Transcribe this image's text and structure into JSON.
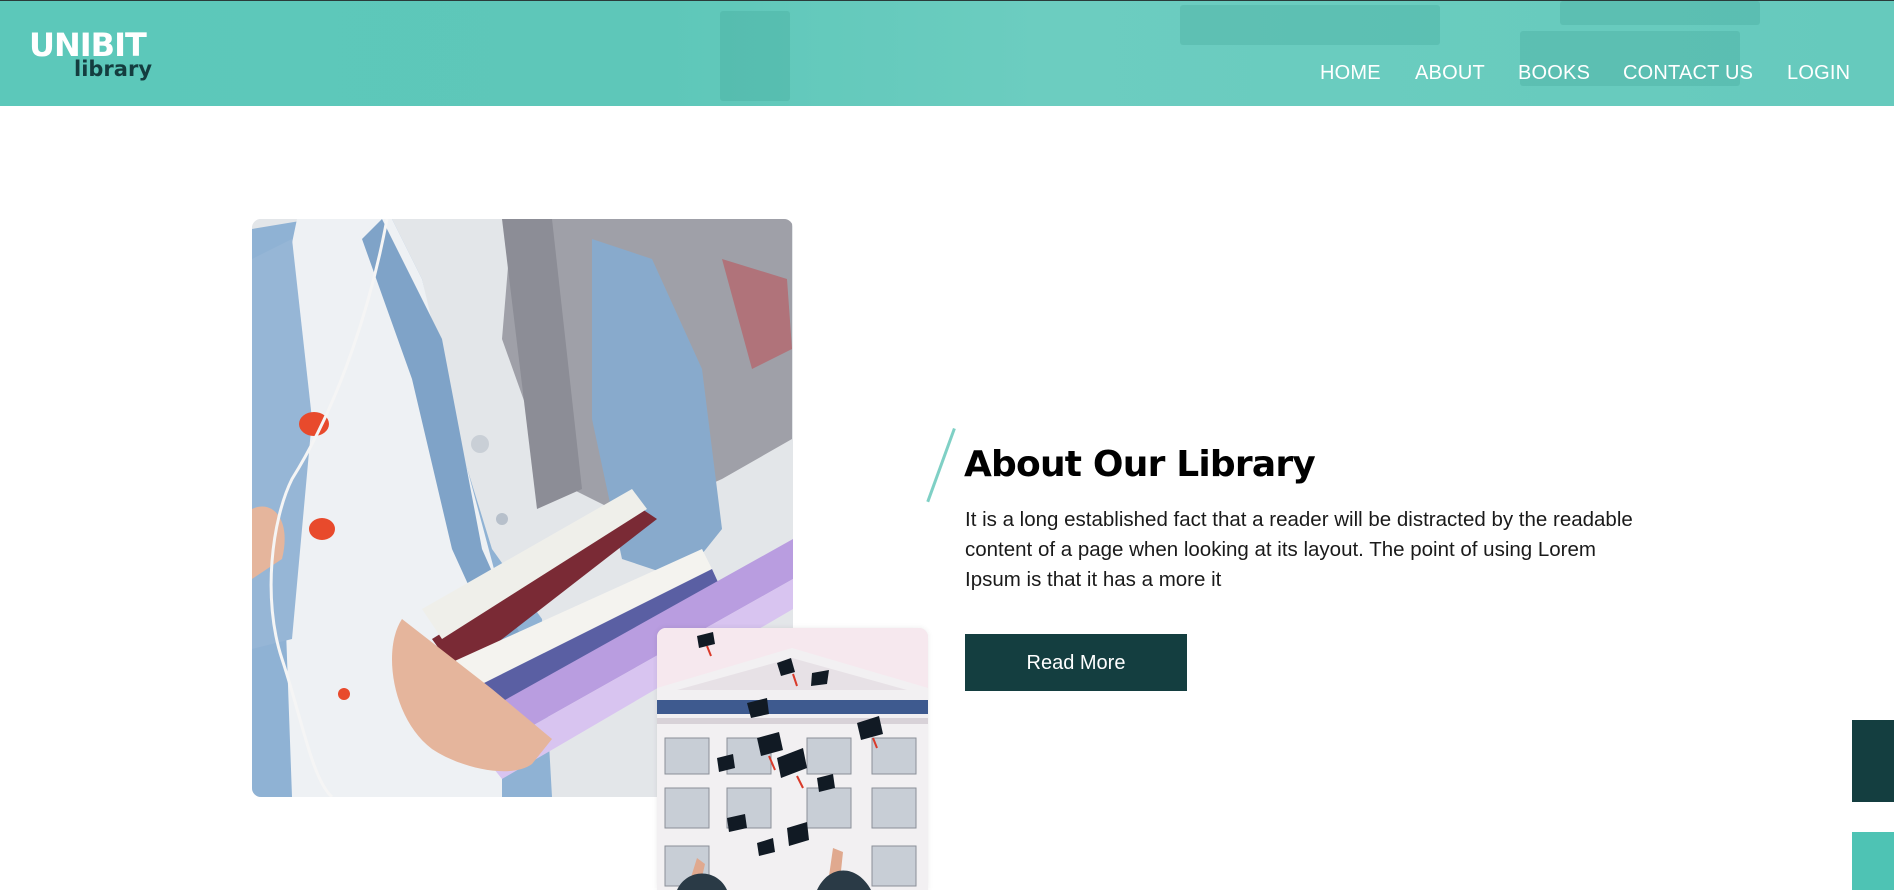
{
  "brand": {
    "name": "UNIBIT",
    "tagline": "library",
    "colors": {
      "header": "#5ec7b9",
      "dark": "#143e40",
      "accent": "#4ec3b4"
    }
  },
  "nav": {
    "items": [
      {
        "label": "HOME"
      },
      {
        "label": "ABOUT"
      },
      {
        "label": "BOOKS"
      },
      {
        "label": "CONTACT US"
      },
      {
        "label": "LOGIN"
      }
    ]
  },
  "images": {
    "main": "student-with-books-photo",
    "secondary": "graduation-caps-photo"
  },
  "about": {
    "title": "About Our Library",
    "text": "It is a long established fact that a reader will be distracted by the readable content of a page when looking at its layout. The point of using Lorem Ipsum is that it has a more it",
    "button_label": "Read More"
  },
  "side_tabs": [
    {
      "color": "#143e40"
    },
    {
      "color": "#4ec3b4"
    }
  ]
}
